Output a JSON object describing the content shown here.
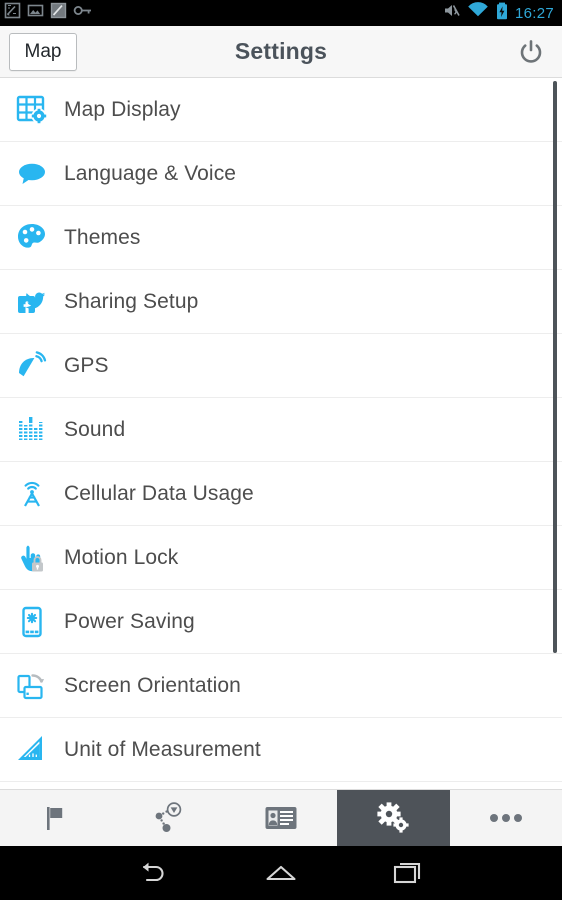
{
  "statusbar": {
    "time": "16:27",
    "left_icons": [
      {
        "name": "screenshot-capture-icon"
      },
      {
        "name": "image-gallery-icon"
      },
      {
        "name": "screenshot-capture-alt-icon"
      },
      {
        "name": "vpn-key-icon"
      }
    ],
    "right_icons": [
      {
        "name": "volume-mute-icon"
      },
      {
        "name": "wifi-icon"
      },
      {
        "name": "battery-charging-icon"
      }
    ],
    "accent_color": "#2fa8d8",
    "background": "#000000"
  },
  "actionbar": {
    "map_button_label": "Map",
    "title": "Settings",
    "power_icon": "power-icon",
    "background": "#f7f7f7",
    "title_color": "#4b535b"
  },
  "list": {
    "accent_color": "#29b6f0",
    "text_color": "#4d4d4d",
    "items": [
      {
        "label": "Map Display",
        "icon": "map-display-icon"
      },
      {
        "label": "Language & Voice",
        "icon": "speech-bubble-icon"
      },
      {
        "label": "Themes",
        "icon": "paint-palette-icon"
      },
      {
        "label": "Sharing Setup",
        "icon": "social-share-icon"
      },
      {
        "label": "GPS",
        "icon": "satellite-dish-icon"
      },
      {
        "label": "Sound",
        "icon": "equalizer-icon"
      },
      {
        "label": "Cellular Data Usage",
        "icon": "cell-tower-icon"
      },
      {
        "label": "Motion Lock",
        "icon": "hand-lock-icon"
      },
      {
        "label": "Power Saving",
        "icon": "phone-power-icon"
      },
      {
        "label": "Screen Orientation",
        "icon": "screen-rotate-icon"
      },
      {
        "label": "Unit of Measurement",
        "icon": "ruler-triangle-icon"
      }
    ]
  },
  "tabbar": {
    "selected_index": 3,
    "selected_background": "#4e5359",
    "icon_color": "#6d747c",
    "tabs": [
      {
        "name": "flag-icon",
        "label": "Flag"
      },
      {
        "name": "route-icon",
        "label": "Route"
      },
      {
        "name": "id-card-icon",
        "label": "Contacts"
      },
      {
        "name": "gears-icon",
        "label": "Settings"
      },
      {
        "name": "overflow-dots-icon",
        "label": "More"
      }
    ]
  },
  "navbar": {
    "buttons": [
      {
        "name": "back-icon",
        "label": "Back"
      },
      {
        "name": "home-icon",
        "label": "Home"
      },
      {
        "name": "recents-icon",
        "label": "Recents"
      }
    ],
    "background": "#000000"
  }
}
